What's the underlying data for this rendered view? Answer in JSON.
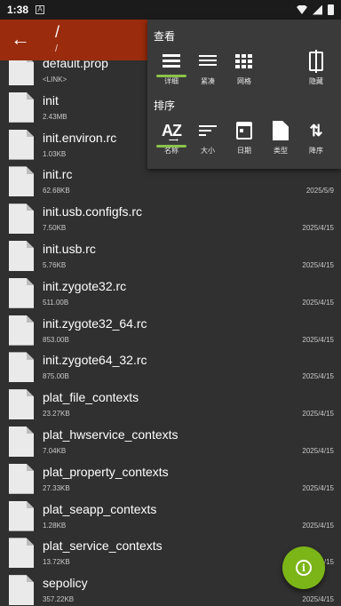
{
  "status": {
    "time": "1:38",
    "app_icon": "A"
  },
  "appbar": {
    "title": "/",
    "subtitle": "/"
  },
  "files": [
    {
      "name": "default.prop",
      "size": "<LINK>",
      "date": ""
    },
    {
      "name": "init",
      "size": "2.43MB",
      "date": ""
    },
    {
      "name": "init.environ.rc",
      "size": "1.03KB",
      "date": ""
    },
    {
      "name": "init.rc",
      "size": "62.68KB",
      "date": "2025/5/9"
    },
    {
      "name": "init.usb.configfs.rc",
      "size": "7.50KB",
      "date": "2025/4/15"
    },
    {
      "name": "init.usb.rc",
      "size": "5.76KB",
      "date": "2025/4/15"
    },
    {
      "name": "init.zygote32.rc",
      "size": "511.00B",
      "date": "2025/4/15"
    },
    {
      "name": "init.zygote32_64.rc",
      "size": "853.00B",
      "date": "2025/4/15"
    },
    {
      "name": "init.zygote64_32.rc",
      "size": "875.00B",
      "date": "2025/4/15"
    },
    {
      "name": "plat_file_contexts",
      "size": "23.27KB",
      "date": "2025/4/15"
    },
    {
      "name": "plat_hwservice_contexts",
      "size": "7.04KB",
      "date": "2025/4/15"
    },
    {
      "name": "plat_property_contexts",
      "size": "27.33KB",
      "date": "2025/4/15"
    },
    {
      "name": "plat_seapp_contexts",
      "size": "1.28KB",
      "date": "2025/4/15"
    },
    {
      "name": "plat_service_contexts",
      "size": "13.72KB",
      "date": "2025/4/15"
    },
    {
      "name": "sepolicy",
      "size": "357.22KB",
      "date": "2025/4/15"
    }
  ],
  "popup": {
    "view_title": "查看",
    "view_options": [
      {
        "label": "详细",
        "icon": "list-view-icon",
        "selected": true
      },
      {
        "label": "紧凑",
        "icon": "compact-view-icon",
        "selected": false
      },
      {
        "label": "网格",
        "icon": "grid-view-icon",
        "selected": false
      },
      {
        "label": "隐藏",
        "icon": "hidden-files-icon",
        "selected": false
      }
    ],
    "sort_title": "排序",
    "sort_options": [
      {
        "label": "名称",
        "icon": "sort-by-name-icon",
        "glyph": "A͢Z",
        "selected": true
      },
      {
        "label": "大小",
        "icon": "sort-by-size-icon",
        "selected": false
      },
      {
        "label": "日期",
        "icon": "calendar-icon",
        "selected": false
      },
      {
        "label": "类型",
        "icon": "file-type-icon",
        "selected": false
      },
      {
        "label": "降序",
        "icon": "sort-order-icon",
        "glyph": "⇅",
        "selected": false
      }
    ]
  },
  "fab": {
    "glyph": "i"
  },
  "colors": {
    "appbar": "#9a2b0c",
    "accent": "#8bc34a",
    "fab": "#7cb518"
  }
}
